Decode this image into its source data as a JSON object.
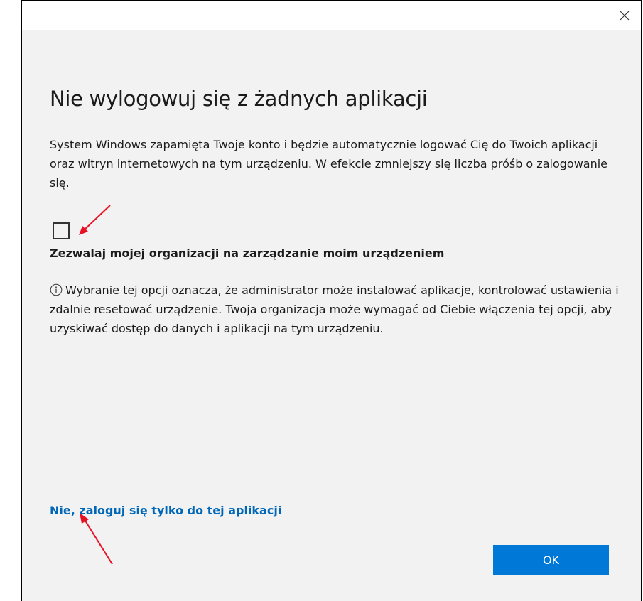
{
  "dialog": {
    "title": "Nie wylogowuj się z żadnych aplikacji",
    "description": "System Windows zapamięta Twoje konto i będzie automatycznie logować Cię do Twoich aplikacji oraz witryn internetowych na tym urządzeniu. W efekcie zmniejszy się liczba próśb o zalogowanie się.",
    "checkbox": {
      "checked": false,
      "label": "Zezwalaj mojej organizacji na zarządzanie moim urządzeniem"
    },
    "info_text": "Wybranie tej opcji oznacza, że administrator może instalować aplikacje, kontrolować ustawienia i zdalnie resetować urządzenie. Twoja organizacja może wymagać od Ciebie włączenia tej opcji, aby uzyskiwać dostęp do danych i aplikacji na tym urządzeniu.",
    "link_text": "Nie, zaloguj się tylko do tej aplikacji",
    "ok_label": "OK"
  },
  "icons": {
    "close": "close-icon",
    "info": "info-icon",
    "annotation_arrows": "arrow-icon"
  },
  "colors": {
    "dialog_bg": "#f2f2f2",
    "titlebar_bg": "#ffffff",
    "accent": "#0078d7",
    "link": "#0067b8",
    "annotation_arrow": "#e81123"
  }
}
